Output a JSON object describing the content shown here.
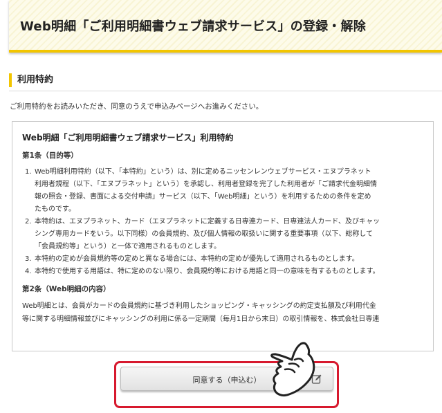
{
  "header": {
    "title": "Web明細「ご利用明細書ウェブ請求サービス」の登録・解除"
  },
  "section": {
    "heading": "利用特約",
    "intro": "ご利用特約をお読みいただき、同意のうえで申込みページへお進みください。"
  },
  "terms": {
    "title": "Web明細「ご利用明細書ウェブ請求サービス」利用特約",
    "article1": {
      "heading": "第1条（目的等）",
      "items": [
        {
          "num": "1.",
          "lines": [
            "Web明細利用特約（以下、「本特約」という）は、別に定めるニッセンレンウェブサービス・エヌプラネット",
            "利用者規程（以下、「エヌプラネット」という）を承認し、利用者登録を完了した利用者が「ご請求代金明細情",
            "報の照会・登録、書面による交付申請」サービス（以下、「Web明細」という）を利用するための条件を定め",
            "たものです。"
          ]
        },
        {
          "num": "2.",
          "lines": [
            "本特約は、エヌプラネット、カード（エヌプラネットに定義する日専連カード、日専連法人カード、及びキャッ",
            "シング専用カードをいう。以下同様）の会員規約、及び個人情報の取扱いに関する重要事項（以下、総称して",
            "「会員規約等」という）と一体で適用されるものとします。"
          ]
        },
        {
          "num": "3.",
          "lines": [
            "本特約の定めが会員規約等の定めと異なる場合には、本特約の定めが優先して適用されるものとします。"
          ]
        },
        {
          "num": "4.",
          "lines": [
            "本特約で使用する用語は、特に定めのない限り、会員規約等における用語と同一の意味を有するものとします。"
          ]
        }
      ]
    },
    "article2": {
      "heading": "第2条（Web明細の内容）",
      "lines": [
        "Web明細とは、会員がカードの会員規約に基づき利用したショッピング・キャッシングの約定支払額及び利用代金",
        "等に関する明細情報並びにキャッシングの利用に係る一定期間（毎月1日から末日）の取引情報を、株式会社日専連"
      ]
    }
  },
  "agree_button": {
    "label": "同意する（申込む）",
    "icon": "edit-icon"
  },
  "overlay": {
    "icon": "pointing-hand-icon"
  },
  "colors": {
    "accent_yellow": "#f2c500",
    "highlight_red": "#d7192e",
    "header_bg": "#fdfbea"
  }
}
